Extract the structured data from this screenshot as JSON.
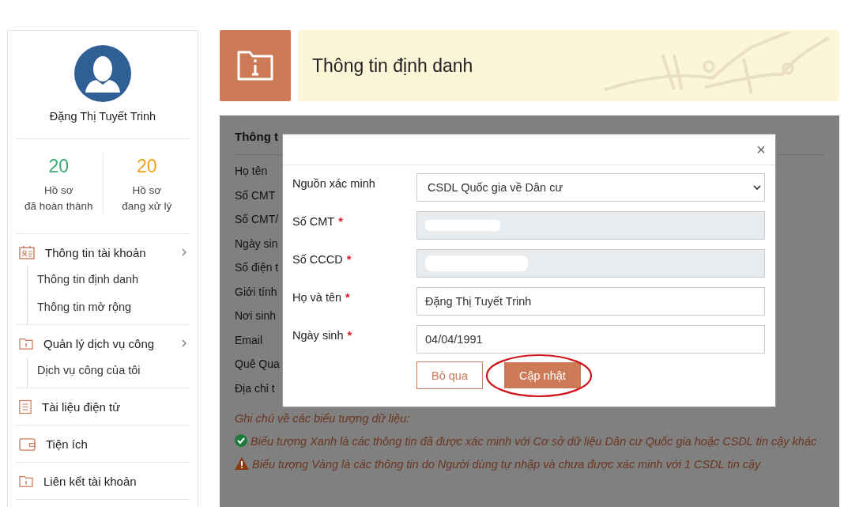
{
  "sidebar": {
    "user_name": "Đặng Thị Tuyết Trinh",
    "stats": [
      {
        "count": "20",
        "label_line1": "Hồ sơ",
        "label_line2": "đã hoàn thành",
        "color": "#3aaa6e"
      },
      {
        "count": "20",
        "label_line1": "Hồ sơ",
        "label_line2": "đang xử lý",
        "color": "#f0a020"
      }
    ],
    "menu": [
      {
        "label": "Thông tin tài khoản",
        "has_arrow": true,
        "children": [
          {
            "label": "Thông tin định danh"
          },
          {
            "label": "Thông tin mở rộng"
          }
        ]
      },
      {
        "label": "Quản lý dịch vụ công",
        "has_arrow": true,
        "children": [
          {
            "label": "Dịch vụ công của tôi"
          }
        ]
      },
      {
        "label": "Tài liệu điện tử",
        "has_arrow": false
      },
      {
        "label": "Tiện ích",
        "has_arrow": false
      },
      {
        "label": "Liên kết tài khoản",
        "has_arrow": false
      }
    ]
  },
  "page_header": {
    "title": "Thông tin định danh"
  },
  "panel": {
    "heading": "Thông t",
    "labels": [
      "Họ tên",
      "Số CMT",
      "Số CMT/",
      "Ngày sin",
      "Số điện t",
      "Giới tính",
      "Nơi sinh",
      "Email",
      "Quê Qua",
      "Địa chỉ t"
    ],
    "notes": [
      {
        "kind": "title",
        "text": "Ghi chú về các biểu tượng dữ liệu:"
      },
      {
        "kind": "verified",
        "text": "Biểu tượng Xanh là các thông tin đã được xác minh với Cơ sở dữ liệu Dân cư Quốc gia hoặc CSDL tin cậy khác"
      },
      {
        "kind": "warning",
        "text": "Biểu tượng Vàng là các thông tin do Người dùng tự nhập và chưa được xác minh với 1 CSDL tin cậy"
      }
    ]
  },
  "modal": {
    "close": "×",
    "fields": [
      {
        "label": "Nguồn xác minh",
        "kind": "select",
        "value": "CSDL Quốc gia về Dân cư"
      },
      {
        "label": "Số CMT",
        "kind": "readonly",
        "required_mark": "*"
      },
      {
        "label": "Số CCCD",
        "kind": "readonly",
        "required_mark": "*"
      },
      {
        "label": "Họ và tên",
        "kind": "text",
        "value": "Đặng Thị Tuyết Trinh",
        "required_mark": "*"
      },
      {
        "label": "Ngày sinh",
        "kind": "text",
        "value": "04/04/1991",
        "required_mark": "*"
      }
    ],
    "buttons": [
      {
        "label": "Bỏ qua",
        "kind": "secondary",
        "highlighted": false
      },
      {
        "label": "Cập nhật",
        "kind": "primary",
        "highlighted": true
      }
    ]
  }
}
